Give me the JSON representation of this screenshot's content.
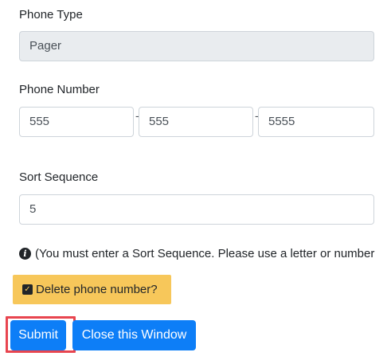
{
  "phone_type": {
    "label": "Phone Type",
    "value": "Pager"
  },
  "phone_number": {
    "label": "Phone Number",
    "area_code": "555",
    "separator_1": "-",
    "prefix": "555",
    "separator_2": "-",
    "line": "5555"
  },
  "sort_sequence": {
    "label": "Sort Sequence",
    "value": "5"
  },
  "info": {
    "icon": "info-circle-icon",
    "text": "(You must enter a Sort Sequence. Please use a letter or number"
  },
  "delete": {
    "label": "Delete phone number?",
    "checked": true,
    "color": "#f7c75a"
  },
  "buttons": {
    "submit_label": "Submit",
    "close_label": "Close this Window",
    "color": "#0d7ef7",
    "highlight_color": "#e8454f"
  }
}
